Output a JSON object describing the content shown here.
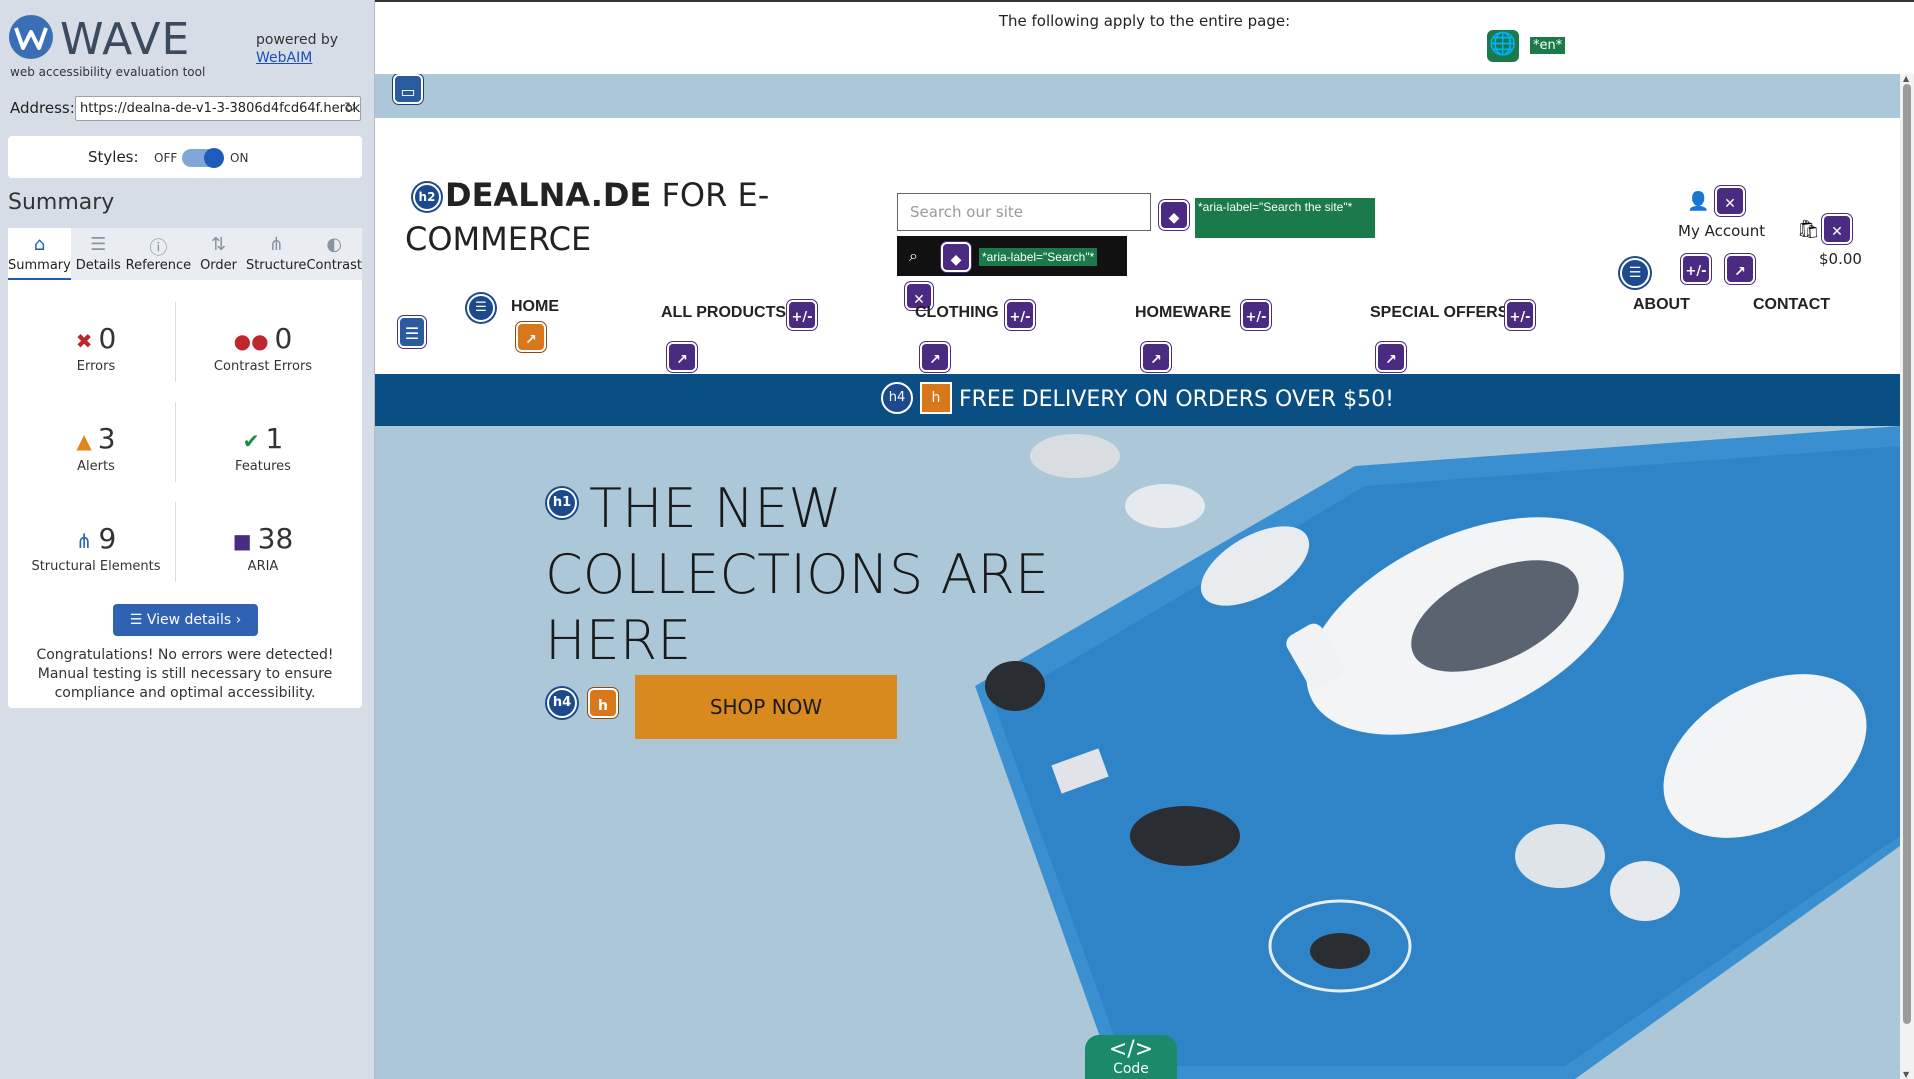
{
  "wave": {
    "name": "WAVE",
    "tagline": "web accessibility evaluation tool",
    "powered_by": "powered by",
    "webaim": "WebAIM",
    "address_label": "Address:",
    "address_value": "https://dealna-de-v1-3-3806d4fcd64f.herok",
    "styles_label": "Styles:",
    "styles_off": "OFF",
    "styles_on": "ON",
    "summary_title": "Summary",
    "tabs": [
      {
        "label": "Summary",
        "icon": "home-icon",
        "glyph": "⌂"
      },
      {
        "label": "Details",
        "icon": "list-icon",
        "glyph": "☰"
      },
      {
        "label": "Reference",
        "icon": "info-icon",
        "glyph": "ⓘ"
      },
      {
        "label": "Order",
        "icon": "order-icon",
        "glyph": "⇅"
      },
      {
        "label": "Structure",
        "icon": "structure-icon",
        "glyph": "⋔"
      },
      {
        "label": "Contrast",
        "icon": "contrast-icon",
        "glyph": "◐"
      }
    ],
    "stats": {
      "errors": {
        "value": "0",
        "label": "Errors"
      },
      "contrast_errors": {
        "value": "0",
        "label": "Contrast Errors"
      },
      "alerts": {
        "value": "3",
        "label": "Alerts"
      },
      "features": {
        "value": "1",
        "label": "Features"
      },
      "structural": {
        "value": "9",
        "label": "Structural Elements"
      },
      "aria": {
        "value": "38",
        "label": "ARIA"
      }
    },
    "view_details": "View details ›",
    "congrats": "Congratulations! No errors were detected! Manual testing is still necessary to ensure compliance and optimal accessibility."
  },
  "page_notice": {
    "text": "The following apply to the entire page:",
    "lang": "*en*"
  },
  "site": {
    "title_bold": "DEALNA.DE",
    "title_rest": " FOR E-COMMERCE",
    "search_placeholder": "Search our site",
    "aria_search_site": "*aria-label=\"Search the site\"*",
    "aria_search": "*aria-label=\"Search\"*",
    "my_account": "My Account",
    "cart_total": "$0.00",
    "nav": [
      "HOME",
      "ALL PRODUCTS",
      "CLOTHING",
      "HOMEWARE",
      "SPECIAL OFFERS",
      "ABOUT",
      "CONTACT"
    ],
    "promo": "FREE DELIVERY ON ORDERS OVER $50!",
    "hero_title": "THE NEW COLLECTIONS ARE HERE",
    "shop_now": "SHOP NOW"
  },
  "badges": {
    "h1": "h1",
    "h2": "h2",
    "h4": "h4",
    "plus_minus": "+/-"
  },
  "code_tab": "Code",
  "colors": {
    "wave_blue": "#1f5bb8",
    "aria_purple": "#4b2a82",
    "promo_blue": "#0a4f84",
    "shop_orange": "#d98a1f"
  }
}
